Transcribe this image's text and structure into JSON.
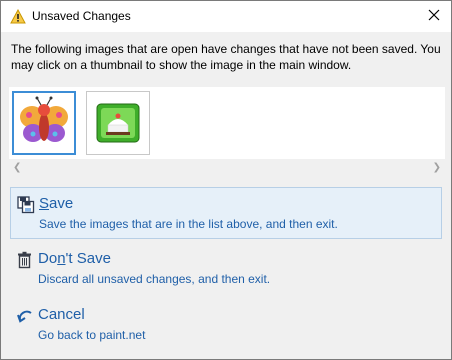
{
  "titlebar": {
    "title": "Unsaved Changes",
    "icon": "warning-icon",
    "close_icon": "close-icon"
  },
  "intro": {
    "text": "The following images that are open have changes that have not been saved. You may click on a thumbnail to show the image in the main window."
  },
  "thumbnails": [
    {
      "name": "butterfly-image",
      "selected": true
    },
    {
      "name": "cake-image",
      "selected": false
    }
  ],
  "options": {
    "save": {
      "title_before": "",
      "title_mnemonic": "S",
      "title_after": "ave",
      "description": "Save the images that are in the list above, and then exit.",
      "icon": "save-icon"
    },
    "dont_save": {
      "title_before": "Do",
      "title_mnemonic": "n",
      "title_after": "'t Save",
      "description": "Discard all unsaved changes, and then exit.",
      "icon": "trash-icon"
    },
    "cancel": {
      "title_before": "",
      "title_mnemonic": "",
      "title_after": "Cancel",
      "description": "Go back to paint.net",
      "icon": "undo-arrow-icon"
    }
  },
  "colors": {
    "link_blue": "#1f5fa8",
    "focus_border": "#b7cfe6",
    "focus_fill": "#e6f0f9",
    "selection_blue": "#3c8dd6"
  }
}
